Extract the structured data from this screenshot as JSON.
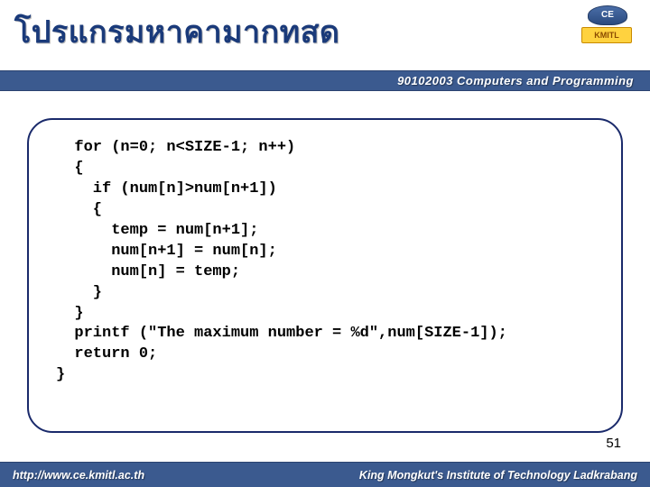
{
  "header": {
    "title": "โปรแกรมหาคามากทสด",
    "logo_top": "CE",
    "logo_bottom": "KMITL"
  },
  "course_bar": "90102003 Computers and Programming",
  "code_lines": "  for (n=0; n<SIZE-1; n++)\n  {\n    if (num[n]>num[n+1])\n    {\n      temp = num[n+1];\n      num[n+1] = num[n];\n      num[n] = temp;\n    }\n  }\n  printf (\"The maximum number = %d\",num[SIZE-1]);\n  return 0;\n}",
  "page_number": "51",
  "footer": {
    "left": "http://www.ce.kmitl.ac.th",
    "right": "King Mongkut's Institute of Technology Ladkrabang"
  }
}
